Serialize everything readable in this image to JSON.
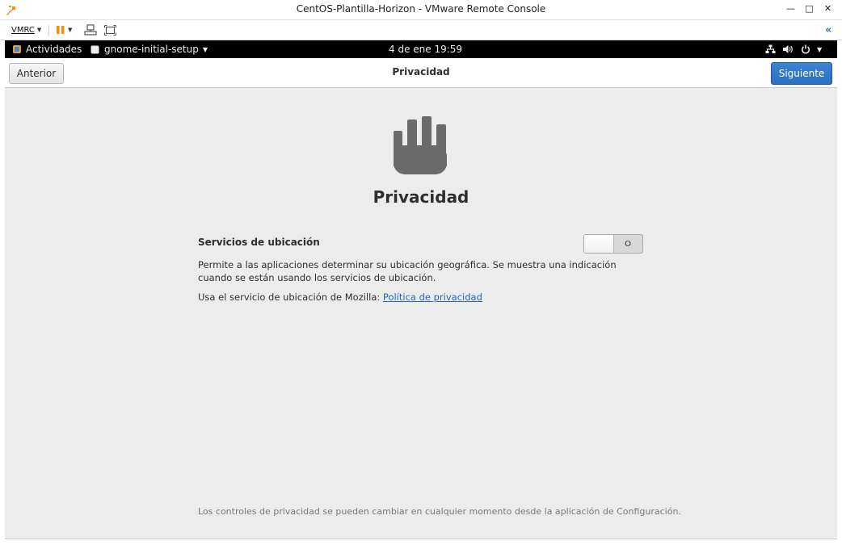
{
  "window": {
    "title": "CentOS-Plantilla-Horizon - VMware Remote Console",
    "minimize": "—",
    "maximize": "□",
    "close": "✕"
  },
  "vmrc": {
    "menu_label": "VMRC",
    "collapse_glyph": "«"
  },
  "gnome": {
    "activities": "Actividades",
    "app_menu": "gnome-initial-setup",
    "clock": "4 de ene  19:59"
  },
  "header": {
    "prev_label": "Anterior",
    "title": "Privacidad",
    "next_label": "Siguiente"
  },
  "content": {
    "heading": "Privacidad",
    "location_title": "Servicios de ubicación",
    "location_toggle_state": "O",
    "location_enabled": false,
    "location_description": "Permite a las aplicaciones determinar su ubicación geográfica. Se muestra una indicación cuando se están usando los servicios de ubicación.",
    "mozilla_text": "Usa el servicio de ubicación de Mozilla: ",
    "privacy_link": "Política de privacidad",
    "footer_note": "Los controles de privacidad se pueden cambiar en cualquier momento desde la aplicación de Configuración."
  },
  "colors": {
    "accent": "#2d6fc0",
    "link": "#2a62b4",
    "background": "#ececec",
    "icon": "#6b6b6b"
  }
}
